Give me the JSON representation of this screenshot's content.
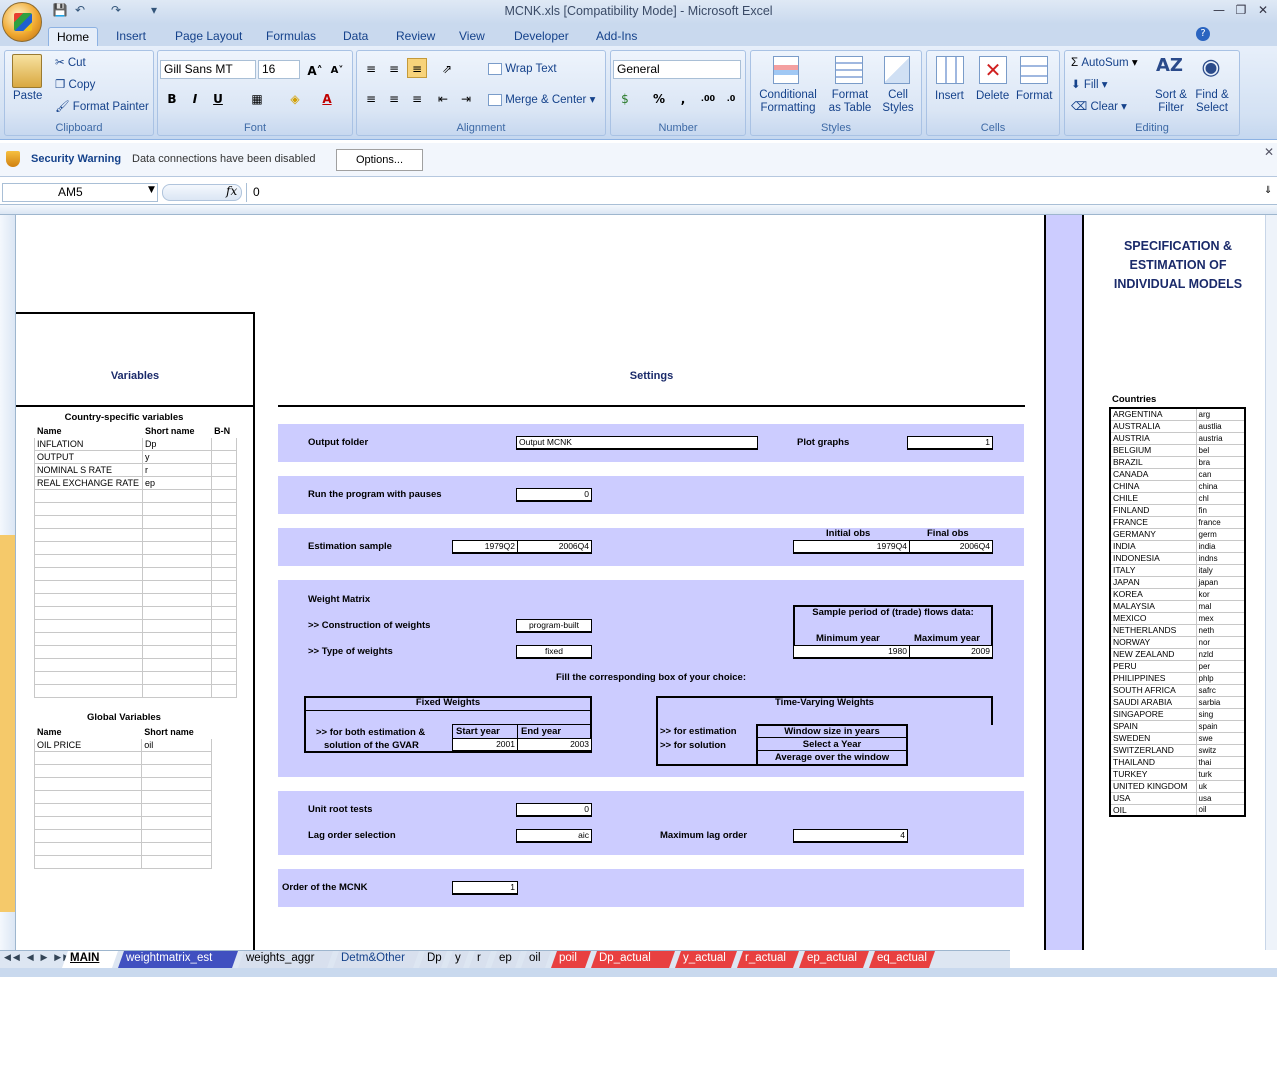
{
  "window": {
    "title": "MCNK.xls  [Compatibility Mode] - Microsoft Excel"
  },
  "ribbon_tabs": [
    "Home",
    "Insert",
    "Page Layout",
    "Formulas",
    "Data",
    "Review",
    "View",
    "Developer",
    "Add-Ins"
  ],
  "clipboard": {
    "paste": "Paste",
    "cut": "Cut",
    "copy": "Copy",
    "format_painter": "Format Painter",
    "label": "Clipboard"
  },
  "font": {
    "name": "Gill Sans MT",
    "size": "16",
    "label": "Font"
  },
  "alignment": {
    "wrap": "Wrap Text",
    "merge": "Merge & Center",
    "label": "Alignment"
  },
  "number": {
    "format": "General",
    "label": "Number"
  },
  "styles": {
    "cond1": "Conditional",
    "cond2": "Formatting",
    "fmt1": "Format",
    "fmt2": "as Table",
    "cell1": "Cell",
    "cell2": "Styles",
    "label": "Styles"
  },
  "cells": {
    "insert": "Insert",
    "delete": "Delete",
    "format": "Format",
    "label": "Cells"
  },
  "editing": {
    "autosum": "AutoSum",
    "fill": "Fill",
    "clear": "Clear",
    "sort1": "Sort &",
    "sort2": "Filter",
    "find1": "Find &",
    "find2": "Select",
    "label": "Editing"
  },
  "security": {
    "title": "Security Warning",
    "message": "Data connections have been disabled",
    "options": "Options..."
  },
  "formula": {
    "namebox": "AM5",
    "fx": "fx",
    "value": "0"
  },
  "sheet": {
    "variables_title": "Variables",
    "settings_title": "Settings",
    "spec_title": "SPECIFICATION & ESTIMATION OF INDIVIDUAL MODELS",
    "country_specific": "Country-specific variables",
    "col_name": "Name",
    "col_short": "Short name",
    "col_bn": "B-N",
    "variables": [
      {
        "name": "INFLATION",
        "short": "Dp"
      },
      {
        "name": "OUTPUT",
        "short": "y"
      },
      {
        "name": "NOMINAL S RATE",
        "short": "r"
      },
      {
        "name": "REAL EXCHANGE RATE",
        "short": "ep"
      }
    ],
    "global_title": "Global Variables",
    "global_vars": [
      {
        "name": "OIL PRICE",
        "short": "oil"
      }
    ],
    "output_folder_label": "Output folder",
    "output_folder": "Output MCNK",
    "plot_graphs_label": "Plot graphs",
    "plot_graphs": "1",
    "pauses_label": "Run the program with pauses",
    "pauses": "0",
    "est_sample_label": "Estimation sample",
    "est_start": "1979Q2",
    "est_end": "2006Q4",
    "initial_obs_label": "Initial obs",
    "final_obs_label": "Final obs",
    "initial_obs": "1979Q4",
    "final_obs": "2006Q4",
    "weight_matrix_label": "Weight Matrix",
    "construction_label": ">> Construction of weights",
    "construction": "program-built",
    "type_label": ">> Type of weights",
    "type": "fixed",
    "sample_period_label": "Sample period of (trade) flows data:",
    "min_year_label": "Minimum year",
    "max_year_label": "Maximum year",
    "min_year": "1980",
    "max_year": "2009",
    "fill_label": "Fill the corresponding box of your choice:",
    "fixed_weights_label": "Fixed Weights",
    "both_label_1": ">> for both estimation &",
    "both_label_2": "solution of the GVAR",
    "start_year_label": "Start year",
    "end_year_label": "End year",
    "start_year": "2001",
    "end_year": "2003",
    "tv_weights_label": "Time-Varying Weights",
    "for_estimation": ">> for estimation",
    "for_solution": ">> for solution",
    "window_size": "Window size in years",
    "select_year": "Select a Year",
    "average_window": "Average over the window",
    "unit_root_label": "Unit root tests",
    "unit_root": "0",
    "lag_order_label": "Lag order selection",
    "lag_order": "aic",
    "max_lag_label": "Maximum lag order",
    "max_lag": "4",
    "order_label": "Order of the MCNK",
    "order": "1",
    "countries_title": "Countries",
    "countries": [
      [
        "ARGENTINA",
        "arg"
      ],
      [
        "AUSTRALIA",
        "austlia"
      ],
      [
        "AUSTRIA",
        "austria"
      ],
      [
        "BELGIUM",
        "bel"
      ],
      [
        "BRAZIL",
        "bra"
      ],
      [
        "CANADA",
        "can"
      ],
      [
        "CHINA",
        "china"
      ],
      [
        "CHILE",
        "chl"
      ],
      [
        "FINLAND",
        "fin"
      ],
      [
        "FRANCE",
        "france"
      ],
      [
        "GERMANY",
        "germ"
      ],
      [
        "INDIA",
        "india"
      ],
      [
        "INDONESIA",
        "indns"
      ],
      [
        "ITALY",
        "italy"
      ],
      [
        "JAPAN",
        "japan"
      ],
      [
        "KOREA",
        "kor"
      ],
      [
        "MALAYSIA",
        "mal"
      ],
      [
        "MEXICO",
        "mex"
      ],
      [
        "NETHERLANDS",
        "neth"
      ],
      [
        "NORWAY",
        "nor"
      ],
      [
        "NEW ZEALAND",
        "nzld"
      ],
      [
        "PERU",
        "per"
      ],
      [
        "PHILIPPINES",
        "phlp"
      ],
      [
        "SOUTH AFRICA",
        "safrc"
      ],
      [
        "SAUDI ARABIA",
        "sarbia"
      ],
      [
        "SINGAPORE",
        "sing"
      ],
      [
        "SPAIN",
        "spain"
      ],
      [
        "SWEDEN",
        "swe"
      ],
      [
        "SWITZERLAND",
        "switz"
      ],
      [
        "THAILAND",
        "thai"
      ],
      [
        "TURKEY",
        "turk"
      ],
      [
        "UNITED KINGDOM",
        "uk"
      ],
      [
        "USA",
        "usa"
      ],
      [
        "OIL",
        "oil"
      ]
    ]
  },
  "sheet_tabs": [
    "MAIN",
    "weightmatrix_est",
    "weights_aggr",
    "Detm&Other",
    "Dp",
    "y",
    "r",
    "ep",
    "oil",
    "poil",
    "Dp_actual",
    "y_actual",
    "r_actual",
    "ep_actual",
    "eq_actual"
  ]
}
